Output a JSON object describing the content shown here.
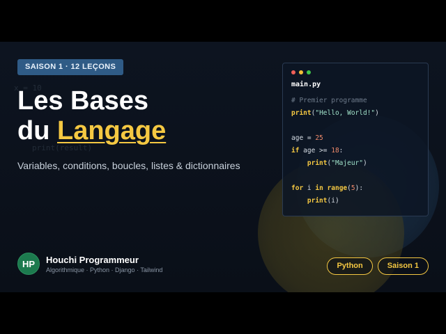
{
  "badge": "SAISON 1 · 12 LEÇONS",
  "title": {
    "line1": "Les Bases",
    "line2_prefix": "du ",
    "line2_accent": "Langage"
  },
  "subtitle": "Variables, conditions, boucles, listes & dictionnaires",
  "code_window": {
    "filename": "main.py",
    "comment": "# Premier programme",
    "print_kw": "print",
    "hello_str": "\"Hello, World!\"",
    "age_assign": "age = ",
    "age_value": "25",
    "if_kw": "if",
    "cond": " age >= ",
    "cond_value": "18",
    "colon": ":",
    "majeur_str": "\"Majeur\"",
    "for_kw": "for",
    "loop_var": " i ",
    "in_kw": "in",
    "range_kw": "range",
    "range_value": "5",
    "print_arg": "i"
  },
  "author": {
    "initials": "HP",
    "name": "Houchi Programmeur",
    "tags": "Algorithmique · Python · Django · Tailwind"
  },
  "pills": [
    "Python",
    "Saison 1"
  ],
  "colors": {
    "accent": "#f5c842",
    "badge_bg": "#2f5b86",
    "avatar_bg": "#1c7a4e"
  }
}
